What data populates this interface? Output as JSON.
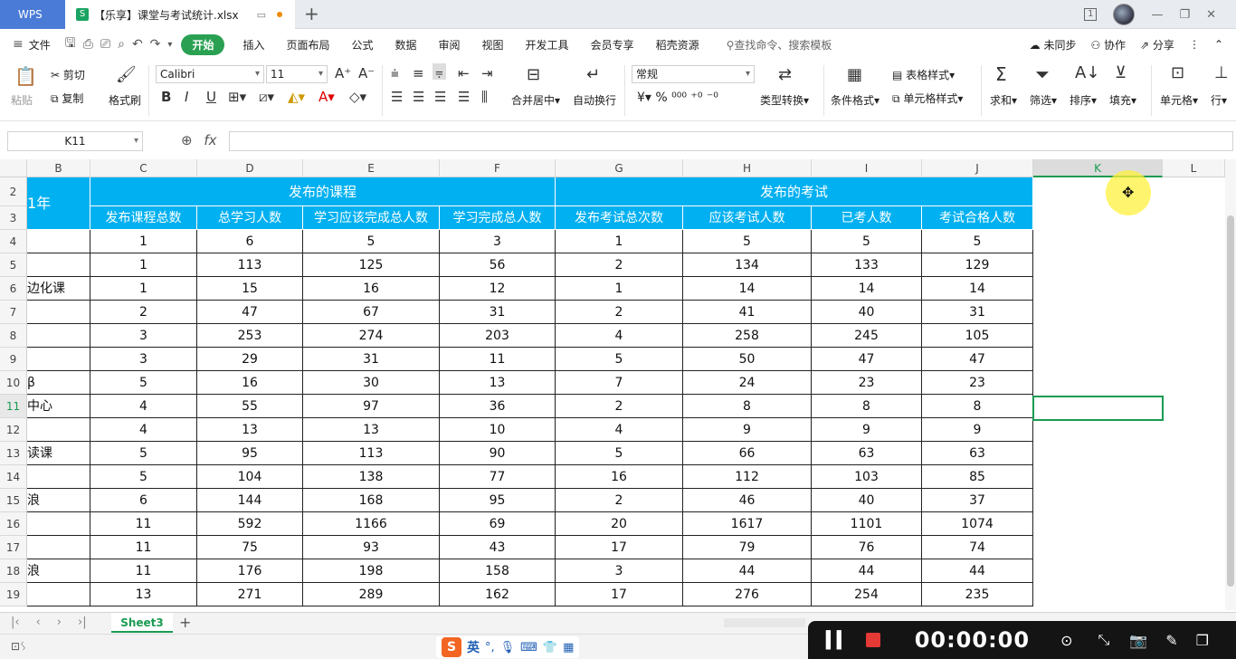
{
  "titlebar": {
    "app_tab": "WPS",
    "doc_icon": "S",
    "doc_title": "【乐享】课堂与考试统计.xlsx",
    "badge": "1"
  },
  "menu": {
    "file": "文件",
    "items": [
      "开始",
      "插入",
      "页面布局",
      "公式",
      "数据",
      "审阅",
      "视图",
      "开发工具",
      "会员专享",
      "稻壳资源"
    ],
    "active": "开始",
    "search": "查找命令、搜索模板",
    "right": [
      "未同步",
      "协作",
      "分享"
    ]
  },
  "ribbon": {
    "paste": "粘贴",
    "cut": "剪切",
    "copy": "复制",
    "format_painter": "格式刷",
    "font": "Calibri",
    "font_size": "11",
    "merge": "合并居中",
    "wrap": "自动换行",
    "number_format": "常规",
    "convert": "类型转换",
    "cond_format": "条件格式",
    "table_style": "表格样式",
    "cell_style": "单元格样式",
    "sum": "求和",
    "filter": "筛选",
    "sort": "排序",
    "fill": "填充",
    "cell": "单元格",
    "row_col": "行"
  },
  "formula_bar": {
    "name_box": "K11",
    "fx": "fx",
    "value": ""
  },
  "sheet": {
    "columns": [
      "B",
      "C",
      "D",
      "E",
      "F",
      "G",
      "H",
      "I",
      "J",
      "K",
      "L"
    ],
    "selected_column": "K",
    "rows": [
      "2",
      "3",
      "4",
      "5",
      "6",
      "7",
      "8",
      "9",
      "10",
      "11",
      "12",
      "13",
      "14",
      "15",
      "16",
      "17",
      "18",
      "19"
    ],
    "selected_row": "11",
    "group_course": "发布的课程",
    "group_exam": "发布的考试",
    "b_header": "1年",
    "headers": [
      "发布课程总数",
      "总学习人数",
      "学习应该完成总人数",
      "学习完成总人数",
      "发布考试总次数",
      "应该考试人数",
      "已考人数",
      "考试合格人数"
    ],
    "b_cells": [
      "",
      "",
      "边化课",
      "",
      "",
      "",
      "β",
      "中心",
      "",
      "读课",
      "",
      "浪",
      "",
      "",
      "浪",
      ""
    ],
    "data": [
      [
        "1",
        "6",
        "5",
        "3",
        "1",
        "5",
        "5",
        "5"
      ],
      [
        "1",
        "113",
        "125",
        "56",
        "2",
        "134",
        "133",
        "129"
      ],
      [
        "1",
        "15",
        "16",
        "12",
        "1",
        "14",
        "14",
        "14"
      ],
      [
        "2",
        "47",
        "67",
        "31",
        "2",
        "41",
        "40",
        "31"
      ],
      [
        "3",
        "253",
        "274",
        "203",
        "4",
        "258",
        "245",
        "105"
      ],
      [
        "3",
        "29",
        "31",
        "11",
        "5",
        "50",
        "47",
        "47"
      ],
      [
        "5",
        "16",
        "30",
        "13",
        "7",
        "24",
        "23",
        "23"
      ],
      [
        "4",
        "55",
        "97",
        "36",
        "2",
        "8",
        "8",
        "8"
      ],
      [
        "4",
        "13",
        "13",
        "10",
        "4",
        "9",
        "9",
        "9"
      ],
      [
        "5",
        "95",
        "113",
        "90",
        "5",
        "66",
        "63",
        "63"
      ],
      [
        "5",
        "104",
        "138",
        "77",
        "16",
        "112",
        "103",
        "85"
      ],
      [
        "6",
        "144",
        "168",
        "95",
        "2",
        "46",
        "40",
        "37"
      ],
      [
        "11",
        "592",
        "1166",
        "69",
        "20",
        "1617",
        "1101",
        "1074"
      ],
      [
        "11",
        "75",
        "93",
        "43",
        "17",
        "79",
        "76",
        "74"
      ],
      [
        "11",
        "176",
        "198",
        "158",
        "3",
        "44",
        "44",
        "44"
      ],
      [
        "13",
        "271",
        "289",
        "162",
        "17",
        "276",
        "254",
        "235"
      ]
    ],
    "header_color": "#00b0f0",
    "tab": "Sheet3"
  },
  "statusbar": {
    "ime_lang": "英",
    "time": "00:00:00"
  }
}
